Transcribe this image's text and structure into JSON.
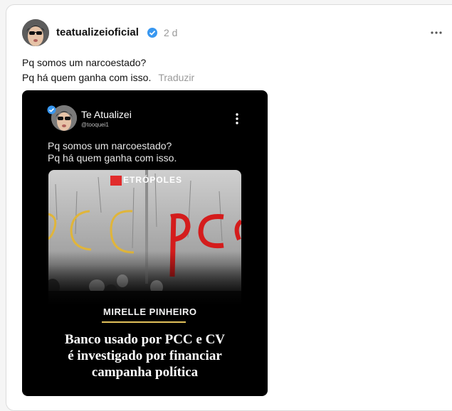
{
  "post": {
    "username": "teatualizeioficial",
    "timestamp": "2 d",
    "caption_lines": [
      "Pq somos um narcoestado?",
      "Pq há quem ganha com isso."
    ],
    "translate_label": "Traduzir"
  },
  "media": {
    "inner_name": "Te Atualizei",
    "inner_handle": "@tooquei1",
    "inner_lines": [
      "Pq somos um narcoestado?",
      "Pq há quem ganha com isso."
    ],
    "brand": "ETRÓPOLES",
    "author": "MIRELLE PINHEIRO",
    "headline_lines": [
      "Banco usado por PCC e CV",
      "é investigado por financiar",
      "campanha política"
    ]
  },
  "colors": {
    "verified": "#3897f0",
    "brand": "#e12b2b",
    "graffiti_yellow": "#e0b53a",
    "graffiti_red": "#d41c1c"
  }
}
